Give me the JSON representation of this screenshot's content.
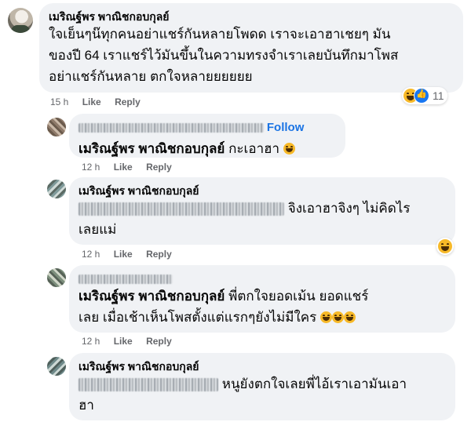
{
  "main_comment": {
    "author": "เมริณฐ์พร พาณิชกอบกุลย์",
    "line1": "ใจเย็นๆน๊ทุกคนอย่าแชร์กันหลายโพดด เราจะเอาฮาเชยๆ มัน",
    "line2": "ของปี 64 เราแชร์ไว้มันขึ้นในความทรงจำเราเลยบันทึกมาโพส",
    "line3": "อย่าแชร์กันหลาย ตกใจหลายยยยยย",
    "time": "15 h",
    "like_label": "Like",
    "reply_label": "Reply",
    "reaction_count": "11"
  },
  "replies": [
    {
      "follow_label": "Follow",
      "mention": "เมริณฐ์พร พาณิชกอบกุลย์",
      "text": "กะเอาฮา",
      "time": "12 h",
      "like_label": "Like",
      "reply_label": "Reply"
    },
    {
      "author": "เมริณฐ์พร พาณิชกอบกุลย์",
      "text_line1": "จิงเอาฮาจิงๆ ไม่คิดไร",
      "text_line2": "เลยแม่",
      "time": "12 h",
      "like_label": "Like",
      "reply_label": "Reply"
    },
    {
      "mention": "เมริณฐ์พร พาณิชกอบกุลย์",
      "text_line1": "พี่ตกใจยอดเม้น ยอดแชร์",
      "text_line2": "เลย เมื่อเช้าเห็นโพสตั้งแต่แรกๆยังไม่มีใคร",
      "time": "12 h",
      "like_label": "Like",
      "reply_label": "Reply"
    },
    {
      "author": "เมริณฐ์พร พาณิชกอบกุลย์",
      "text_line1": "หนูยังตกใจเลยพี่ไอ้เราเอามันเอา",
      "text_line2": "ฮา"
    }
  ],
  "colors": {
    "bubble_bg": "#f0f2f5",
    "meta_text": "#65676b",
    "follow_blue": "#1b74e4"
  },
  "icons": [
    "haha-reaction-icon",
    "like-reaction-icon"
  ]
}
